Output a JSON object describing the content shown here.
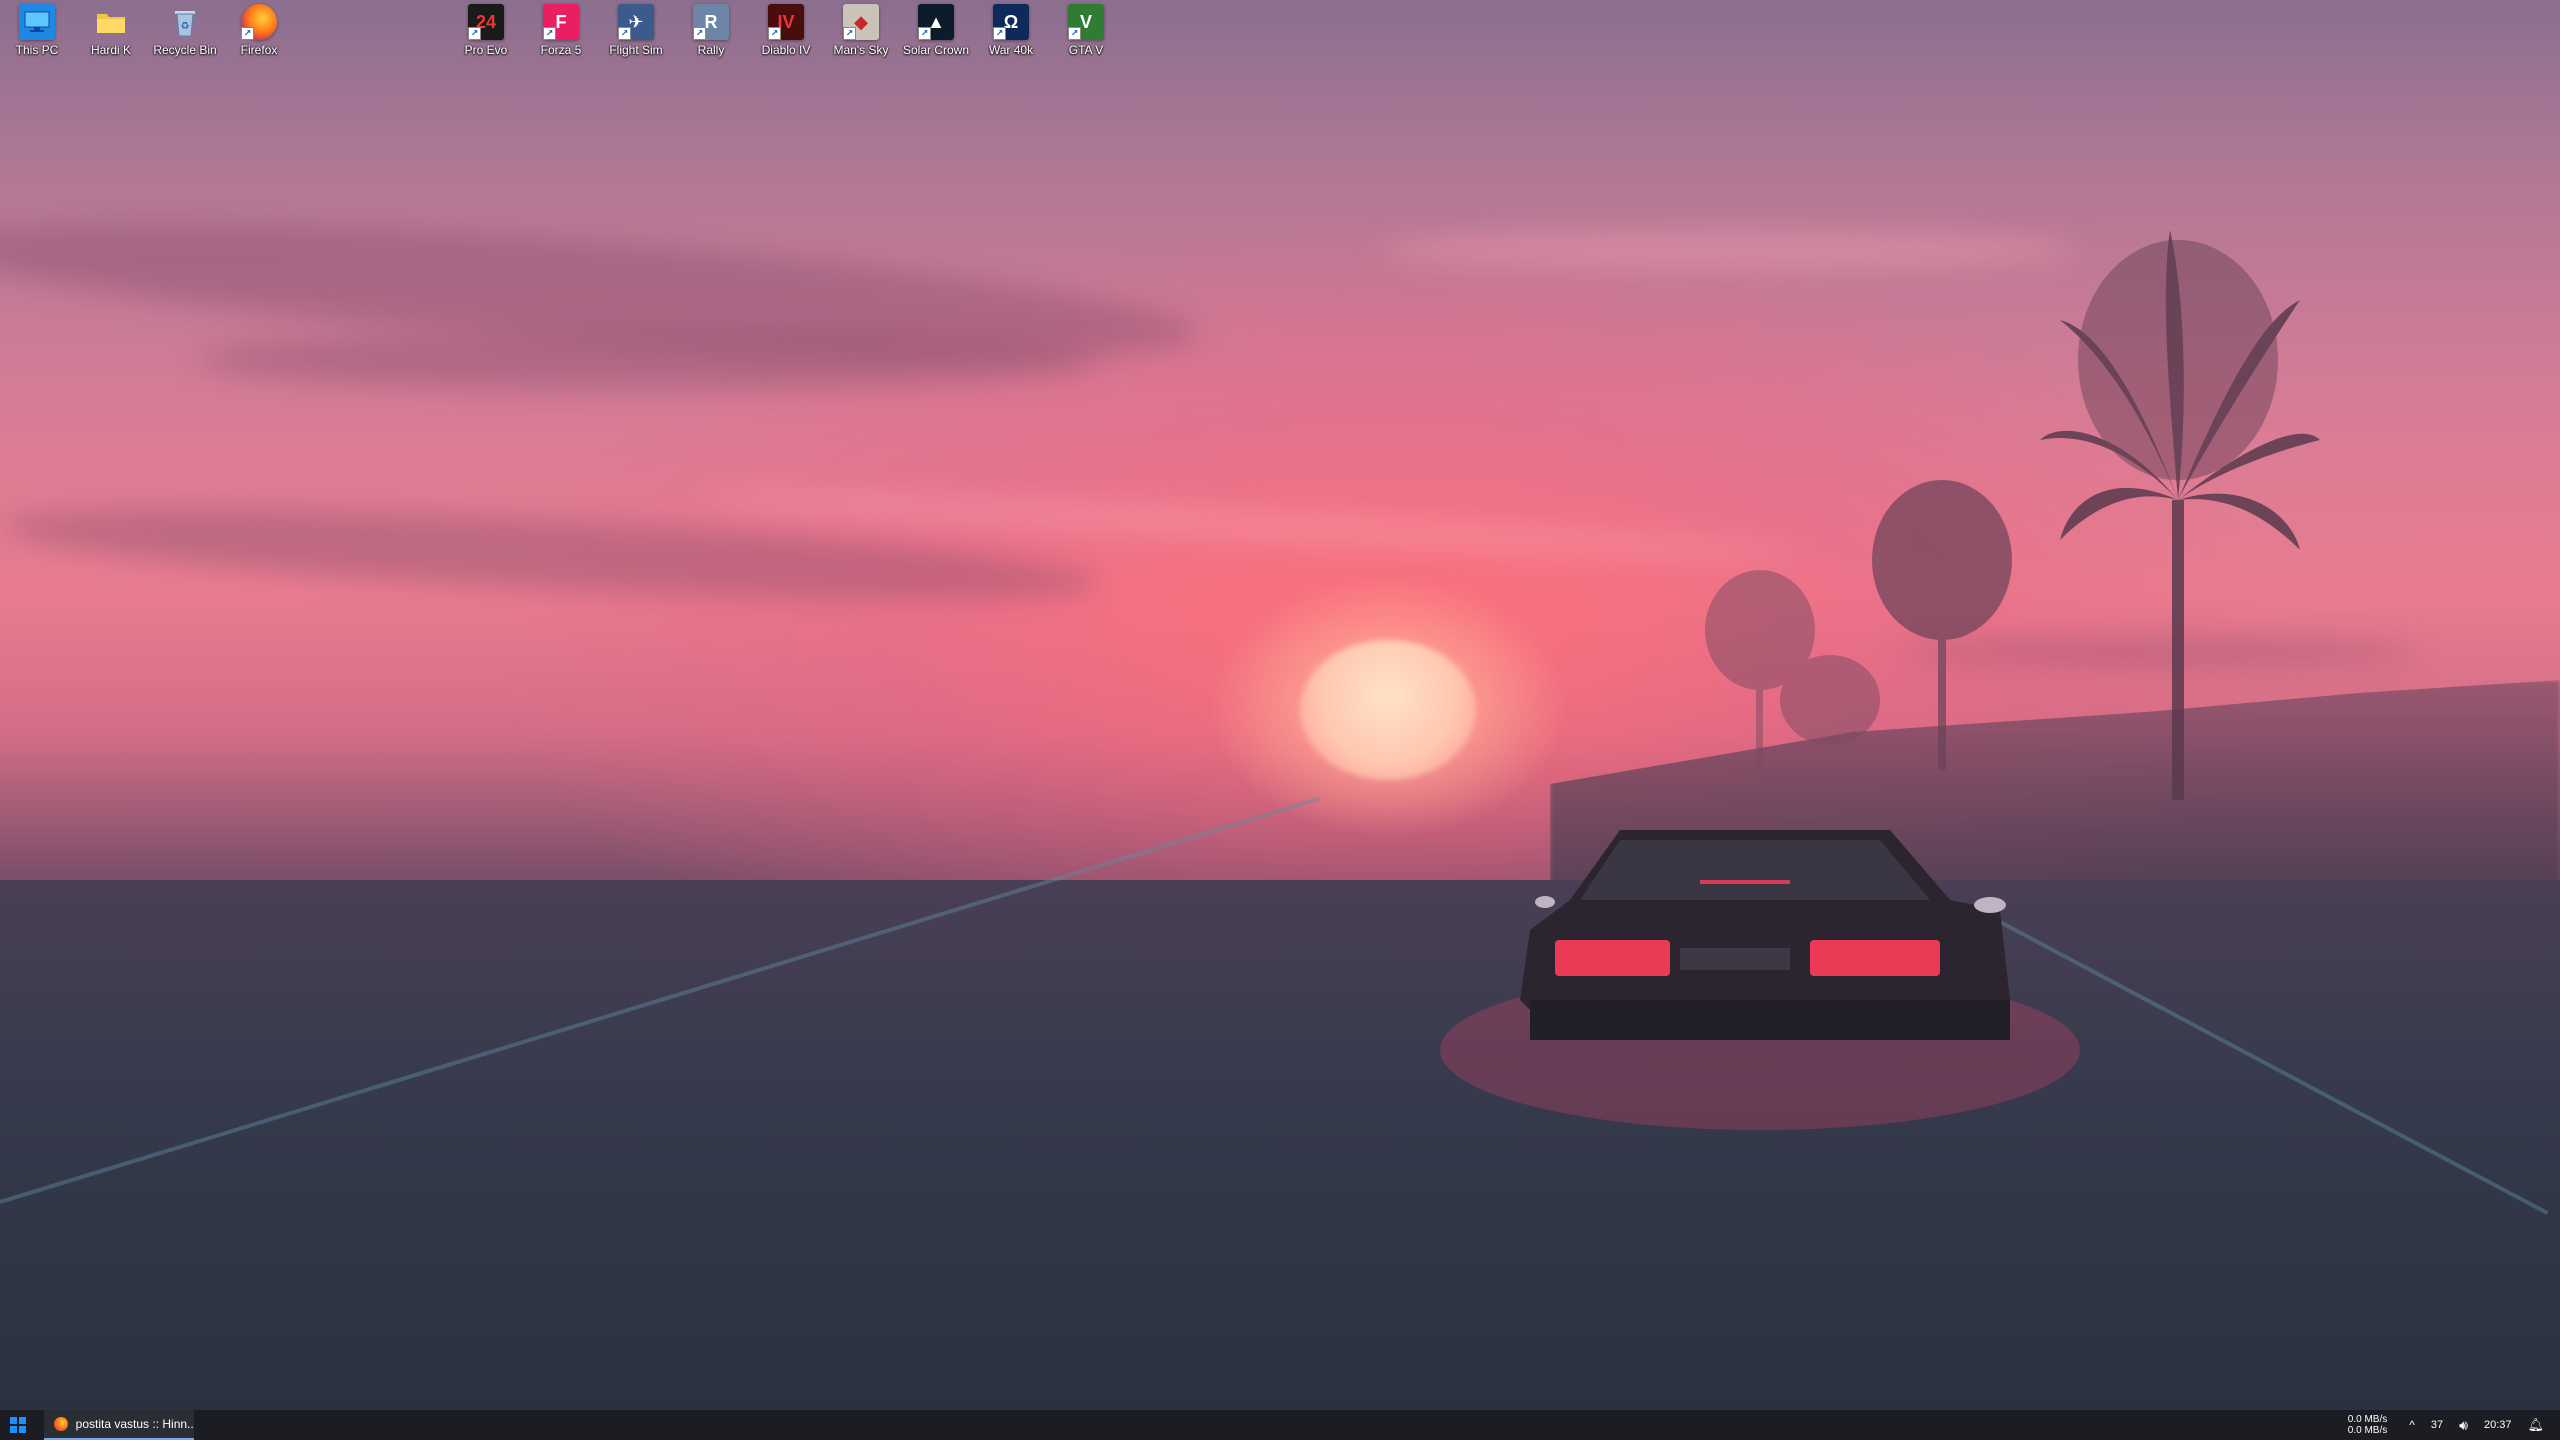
{
  "desktop": {
    "icons_left": [
      {
        "label": "This PC",
        "icon": "monitor-icon",
        "color": "#1e88e5"
      },
      {
        "label": "Hardi K",
        "icon": "folder-icon",
        "color": "#f4c542"
      },
      {
        "label": "Recycle Bin",
        "icon": "recycle-bin-icon",
        "color": "#a8c4e0"
      },
      {
        "label": "Firefox",
        "icon": "firefox-icon",
        "color": "#ff7a1a"
      }
    ],
    "icons_games": [
      {
        "label": "Pro Evo",
        "glyph": "24",
        "bg": "#1a1a1a",
        "fg": "#e53935"
      },
      {
        "label": "Forza 5",
        "glyph": "F",
        "bg": "#e91e63",
        "fg": "#ffffff"
      },
      {
        "label": "Flight Sim",
        "glyph": "✈",
        "bg": "#3a5b8c",
        "fg": "#ffffff"
      },
      {
        "label": "Rally",
        "glyph": "R",
        "bg": "#6d86a8",
        "fg": "#ffffff"
      },
      {
        "label": "Diablo IV",
        "glyph": "IV",
        "bg": "#4a0d0d",
        "fg": "#e53935"
      },
      {
        "label": "Man's Sky",
        "glyph": "◆",
        "bg": "#c9c3b8",
        "fg": "#c62828"
      },
      {
        "label": "Solar Crown",
        "glyph": "▲",
        "bg": "#0d1b2a",
        "fg": "#ffffff"
      },
      {
        "label": "War 40k",
        "glyph": "Ω",
        "bg": "#0d2a5a",
        "fg": "#ffffff"
      },
      {
        "label": "GTA V",
        "glyph": "V",
        "bg": "#2e7d32",
        "fg": "#ffffff"
      }
    ]
  },
  "taskbar": {
    "window_title": "postita vastus :: Hinn...",
    "net_up": "0.0 MB/s",
    "net_down": "0.0 MB/s",
    "temperature": "37",
    "clock": "20:37"
  }
}
